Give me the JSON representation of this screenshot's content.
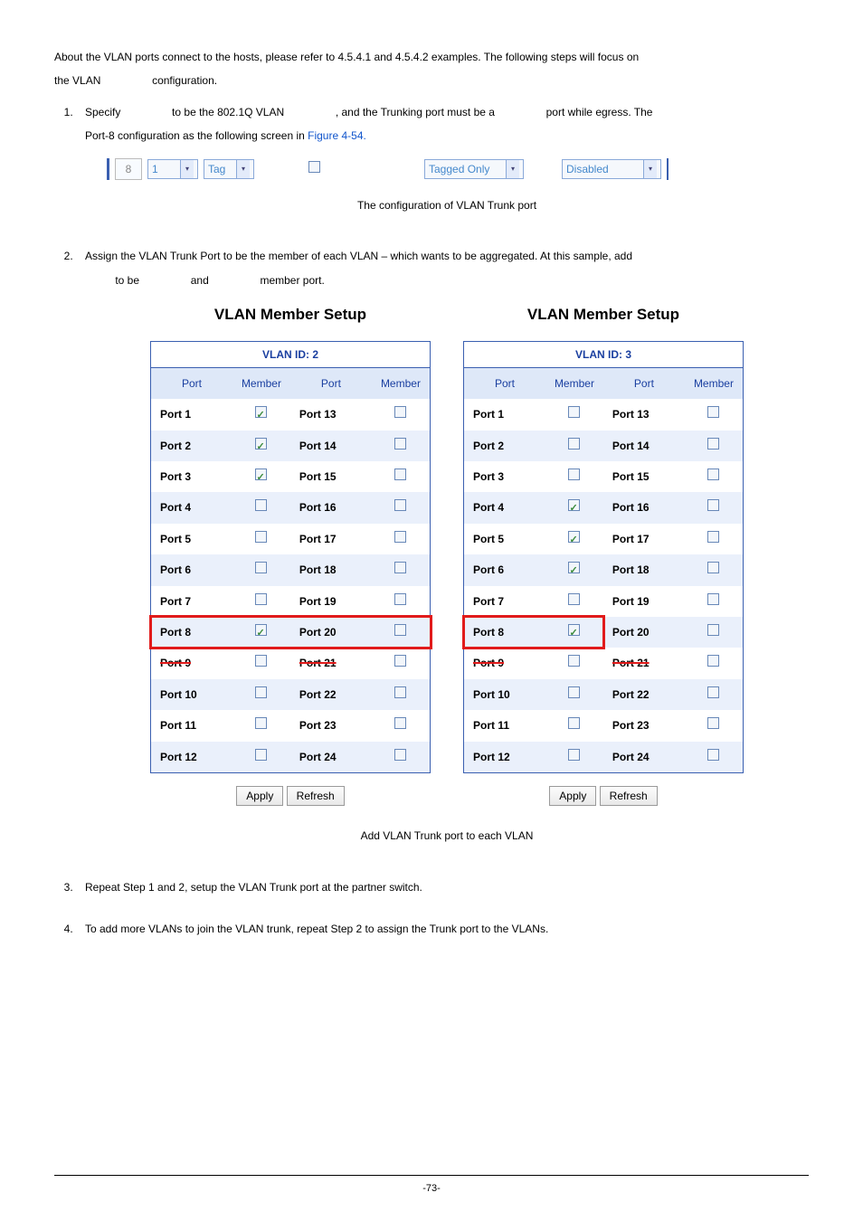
{
  "intro": {
    "p1a": "About the VLAN ports connect to the hosts, please refer to 4.5.4.1 and 4.5.4.2 examples. The following steps will focus on",
    "p1b": "the VLAN",
    "p1c": "configuration."
  },
  "step1": {
    "a": "Specify",
    "b": "to be the 802.1Q VLAN",
    "c": ", and the Trunking port must be a",
    "d": "port while egress. The",
    "e": "Port-8 configuration as the following screen in ",
    "figref": "Figure 4-54."
  },
  "port_row": {
    "port_num": "8",
    "pvid_val": "1",
    "tag_sel": "Tag",
    "untagged_chk": false,
    "accept_sel": "Tagged Only",
    "ingress_sel": "Disabled"
  },
  "caption1": "The configuration of VLAN Trunk port",
  "step2": {
    "a": "Assign the VLAN Trunk Port to be the member of each VLAN – which wants to be aggregated. At this sample, add",
    "b": "to be",
    "c": "and",
    "d": "member port."
  },
  "panel_title": "VLAN Member Setup",
  "hdr": {
    "port": "Port",
    "member": "Member"
  },
  "apply": "Apply",
  "refresh": "Refresh",
  "vlan_left": {
    "id_label": "VLAN ID: 2",
    "rows": [
      {
        "a": "Port 1",
        "ac": true,
        "b": "Port 13",
        "bc": false,
        "alt": false
      },
      {
        "a": "Port 2",
        "ac": true,
        "b": "Port 14",
        "bc": false,
        "alt": true
      },
      {
        "a": "Port 3",
        "ac": true,
        "b": "Port 15",
        "bc": false,
        "alt": false
      },
      {
        "a": "Port 4",
        "ac": false,
        "b": "Port 16",
        "bc": false,
        "alt": true
      },
      {
        "a": "Port 5",
        "ac": false,
        "b": "Port 17",
        "bc": false,
        "alt": false
      },
      {
        "a": "Port 6",
        "ac": false,
        "b": "Port 18",
        "bc": false,
        "alt": true
      },
      {
        "a": "Port 7",
        "ac": false,
        "b": "Port 19",
        "bc": false,
        "alt": false
      },
      {
        "a": "Port 8",
        "ac": true,
        "b": "Port 20",
        "bc": false,
        "alt": true,
        "hl": true
      },
      {
        "a": "Port 9",
        "ac": false,
        "b": "Port 21",
        "bc": false,
        "alt": false,
        "strike": true
      },
      {
        "a": "Port 10",
        "ac": false,
        "b": "Port 22",
        "bc": false,
        "alt": true
      },
      {
        "a": "Port 11",
        "ac": false,
        "b": "Port 23",
        "bc": false,
        "alt": false
      },
      {
        "a": "Port 12",
        "ac": false,
        "b": "Port 24",
        "bc": false,
        "alt": true
      }
    ]
  },
  "vlan_right": {
    "id_label": "VLAN ID: 3",
    "rows": [
      {
        "a": "Port 1",
        "ac": false,
        "b": "Port 13",
        "bc": false,
        "alt": false
      },
      {
        "a": "Port 2",
        "ac": false,
        "b": "Port 14",
        "bc": false,
        "alt": true
      },
      {
        "a": "Port 3",
        "ac": false,
        "b": "Port 15",
        "bc": false,
        "alt": false
      },
      {
        "a": "Port 4",
        "ac": true,
        "b": "Port 16",
        "bc": false,
        "alt": true
      },
      {
        "a": "Port 5",
        "ac": true,
        "b": "Port 17",
        "bc": false,
        "alt": false
      },
      {
        "a": "Port 6",
        "ac": true,
        "b": "Port 18",
        "bc": false,
        "alt": true
      },
      {
        "a": "Port 7",
        "ac": false,
        "b": "Port 19",
        "bc": false,
        "alt": false
      },
      {
        "a": "Port 8",
        "ac": true,
        "b": "Port 20",
        "bc": false,
        "alt": true,
        "hl": true
      },
      {
        "a": "Port 9",
        "ac": false,
        "b": "Port 21",
        "bc": false,
        "alt": false,
        "strike": true
      },
      {
        "a": "Port 10",
        "ac": false,
        "b": "Port 22",
        "bc": false,
        "alt": true
      },
      {
        "a": "Port 11",
        "ac": false,
        "b": "Port 23",
        "bc": false,
        "alt": false
      },
      {
        "a": "Port 12",
        "ac": false,
        "b": "Port 24",
        "bc": false,
        "alt": true
      }
    ]
  },
  "caption2": "Add VLAN Trunk port to each VLAN",
  "step3": "Repeat Step 1 and 2, setup the VLAN Trunk port at the partner switch.",
  "step4": "To add more VLANs to join the VLAN trunk, repeat Step 2 to assign the Trunk port to the VLANs.",
  "pagenum": "-73-"
}
